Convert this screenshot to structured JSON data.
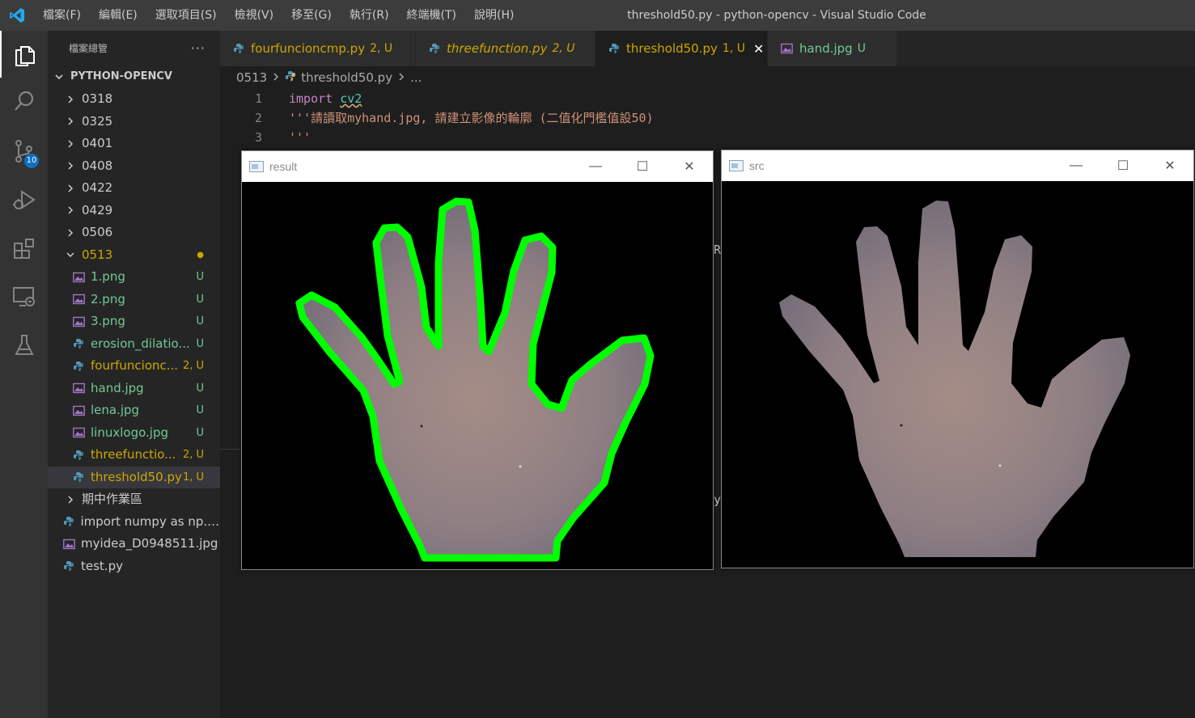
{
  "window": {
    "title": "threshold50.py - python-opencv - Visual Studio Code",
    "menu": [
      "檔案(F)",
      "編輯(E)",
      "選取項目(S)",
      "檢視(V)",
      "移至(G)",
      "執行(R)",
      "終端機(T)",
      "說明(H)"
    ]
  },
  "activity_bar": {
    "source_control_badge": "10",
    "items": [
      "explorer-icon",
      "search-icon",
      "source-control-icon",
      "run-debug-icon",
      "extensions-icon",
      "remote-explorer-icon",
      "testing-icon"
    ]
  },
  "explorer": {
    "title": "檔案總管",
    "more": "···",
    "project": "PYTHON-OPENCV",
    "rows": [
      {
        "name": "0318",
        "type": "folder",
        "open": false,
        "depth": 1,
        "status": "",
        "color": "#cccccc"
      },
      {
        "name": "0325",
        "type": "folder",
        "open": false,
        "depth": 1,
        "status": "",
        "color": "#cccccc"
      },
      {
        "name": "0401",
        "type": "folder",
        "open": false,
        "depth": 1,
        "status": "",
        "color": "#cccccc"
      },
      {
        "name": "0408",
        "type": "folder",
        "open": false,
        "depth": 1,
        "status": "",
        "color": "#cccccc"
      },
      {
        "name": "0422",
        "type": "folder",
        "open": false,
        "depth": 1,
        "status": "",
        "color": "#cccccc"
      },
      {
        "name": "0429",
        "type": "folder",
        "open": false,
        "depth": 1,
        "status": "",
        "color": "#cccccc"
      },
      {
        "name": "0506",
        "type": "folder",
        "open": false,
        "depth": 1,
        "status": "",
        "color": "#cccccc"
      },
      {
        "name": "0513",
        "type": "folder",
        "open": true,
        "depth": 1,
        "status": "●",
        "color": "#cca700"
      },
      {
        "name": "1.png",
        "type": "image",
        "depth": 2,
        "status": "U",
        "color": "#73c991"
      },
      {
        "name": "2.png",
        "type": "image",
        "depth": 2,
        "status": "U",
        "color": "#73c991"
      },
      {
        "name": "3.png",
        "type": "image",
        "depth": 2,
        "status": "U",
        "color": "#73c991"
      },
      {
        "name": "erosion_dilatio...",
        "type": "python",
        "depth": 2,
        "status": "U",
        "color": "#73c991"
      },
      {
        "name": "fourfuncionc...",
        "type": "python",
        "depth": 2,
        "status": "2, U",
        "color": "#cca700"
      },
      {
        "name": "hand.jpg",
        "type": "image",
        "depth": 2,
        "status": "U",
        "color": "#73c991"
      },
      {
        "name": "lena.jpg",
        "type": "image",
        "depth": 2,
        "status": "U",
        "color": "#73c991"
      },
      {
        "name": "linuxlogo.jpg",
        "type": "image",
        "depth": 2,
        "status": "U",
        "color": "#73c991"
      },
      {
        "name": "threefunctio...",
        "type": "python",
        "depth": 2,
        "status": "2, U",
        "color": "#cca700"
      },
      {
        "name": "threshold50.py",
        "type": "python",
        "depth": 2,
        "status": "1, U",
        "color": "#cca700",
        "selected": true
      },
      {
        "name": "期中作業區",
        "type": "folder",
        "open": false,
        "depth": 1,
        "status": "",
        "color": "#cccccc"
      },
      {
        "name": "import numpy as np.py",
        "type": "python",
        "depth": 1,
        "status": "",
        "color": "#cccccc"
      },
      {
        "name": "myidea_D0948511.jpg",
        "type": "image",
        "depth": 1,
        "status": "",
        "color": "#cccccc"
      },
      {
        "name": "test.py",
        "type": "python",
        "depth": 1,
        "status": "",
        "color": "#cccccc"
      }
    ]
  },
  "tabs": [
    {
      "label": "fourfuncioncmp.py",
      "status": "2, U",
      "icon": "python",
      "italic": false,
      "active": false,
      "color": "#cca700"
    },
    {
      "label": "threefunction.py",
      "status": "2, U",
      "icon": "python",
      "italic": true,
      "active": false,
      "color": "#cca700"
    },
    {
      "label": "threshold50.py",
      "status": "1, U",
      "icon": "python",
      "italic": false,
      "active": true,
      "color": "#cca700"
    },
    {
      "label": "hand.jpg",
      "status": "U",
      "icon": "image",
      "italic": false,
      "active": false,
      "color": "#73c991"
    }
  ],
  "tab_close": "✕",
  "breadcrumb": {
    "folder": "0513",
    "file": "threshold50.py",
    "more": "..."
  },
  "code": {
    "line1_num": "1",
    "line1_kw": "import",
    "line1_mod": "cv2",
    "line2_num": "2",
    "line2_text": "'''請讀取myhand.jpg, 請建立影像的輪廓 (二值化門檻值設50)",
    "line3_num": "3",
    "line3_text": "'''"
  },
  "hidden_fragments": {
    "frag_re": "RE",
    "frag_y": "y"
  },
  "cv_windows": {
    "result": {
      "title": "result",
      "minimize": "—",
      "maximize": "☐",
      "close": "✕"
    },
    "src": {
      "title": "src",
      "minimize": "—",
      "maximize": "☐",
      "close": "✕"
    }
  },
  "colors": {
    "contour": "#00ff00",
    "accent": "#0e70c0",
    "modified": "#cca700",
    "untracked": "#73c991"
  }
}
